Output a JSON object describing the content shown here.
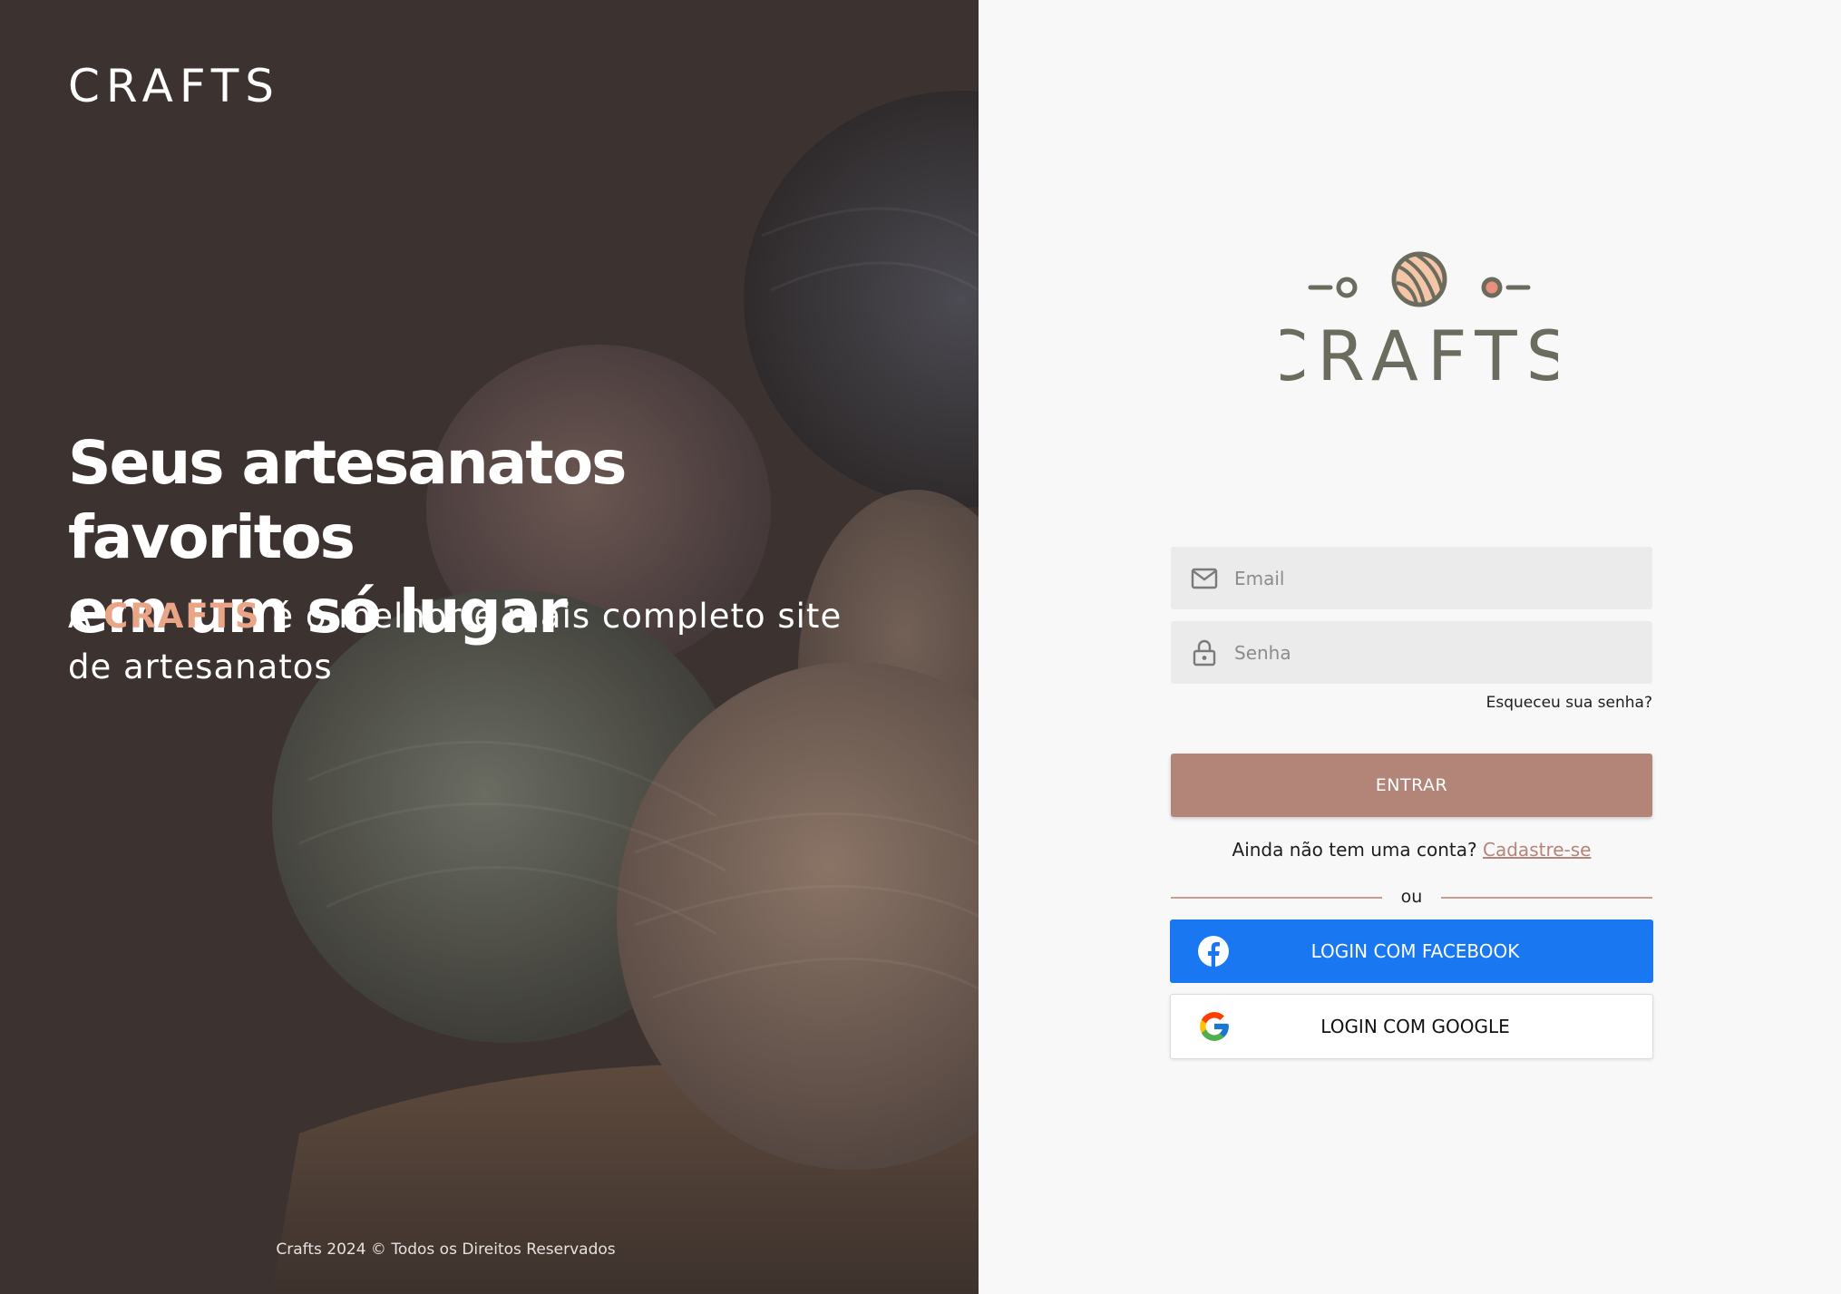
{
  "hero": {
    "brand": "CRAFTS",
    "headline_line1": "Seus artesanatos favoritos",
    "headline_line2": "em um só lugar",
    "sub_prefix": "A ",
    "sub_brand": "CRAFTS",
    "sub_suffix": " é o melhor e mais completo site de artesanatos",
    "footer": "Crafts 2024 © Todos os Direitos Reservados"
  },
  "logo": {
    "text": "CRAFTS",
    "image": "yarn-ball-logo"
  },
  "form": {
    "email_placeholder": "Email",
    "password_placeholder": "Senha",
    "forgot": "Esqueceu sua senha?",
    "submit": "ENTRAR",
    "signup_prompt": "Ainda não tem uma conta?",
    "signup_link": "Cadastre-se",
    "divider": "ou",
    "facebook": "LOGIN COM FACEBOOK",
    "google": "LOGIN COM GOOGLE"
  },
  "icons": {
    "email": "envelope-icon",
    "password": "lock-icon",
    "facebook": "facebook-icon",
    "google": "google-icon"
  },
  "colors": {
    "accent": "#b38578",
    "brand_highlight": "#eaa486",
    "facebook": "#1a77f2",
    "logo_text": "#6b6b5e",
    "hero_overlay": "#3c3331"
  }
}
